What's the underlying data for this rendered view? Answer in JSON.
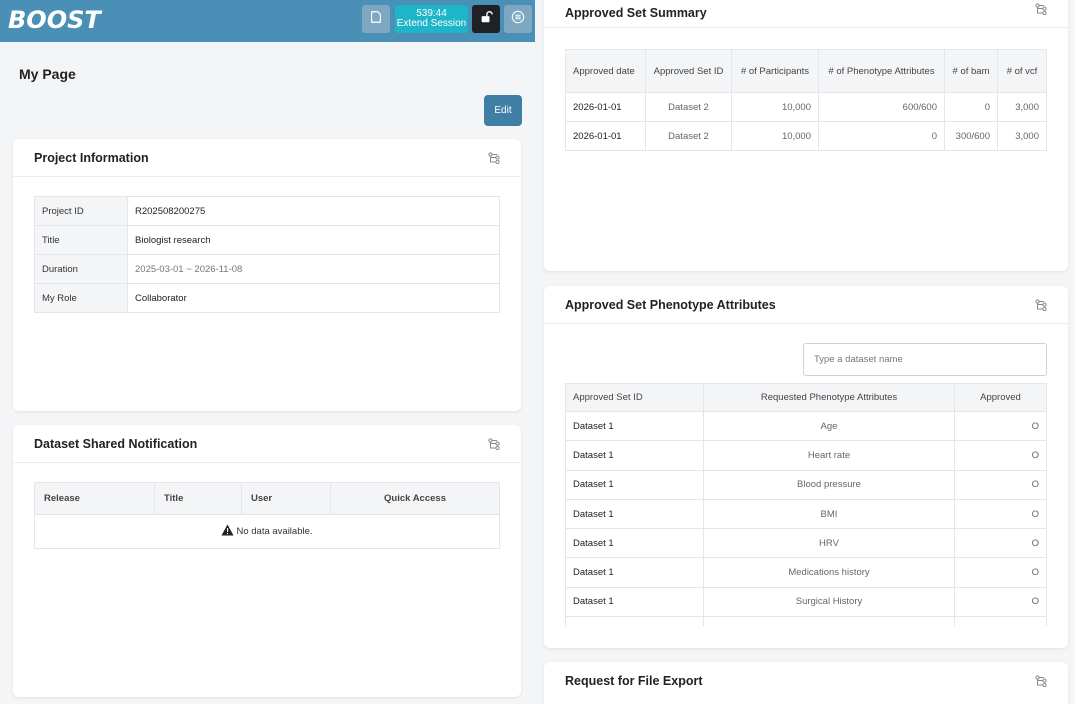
{
  "header": {
    "logo": "BOOST",
    "session_time": "539:44",
    "session_label": "Extend Session"
  },
  "page": {
    "title": "My Page",
    "edit_label": "Edit"
  },
  "project_info": {
    "title": "Project Information",
    "rows": [
      {
        "label": "Project ID",
        "value": "R202508200275"
      },
      {
        "label": "Title",
        "value": "Biologist research"
      },
      {
        "label": "Duration",
        "value": "2025-03-01 ~ 2026-11-08"
      },
      {
        "label": "My Role",
        "value": "Collaborator"
      }
    ]
  },
  "dataset_notification": {
    "title": "Dataset Shared Notification",
    "columns": [
      "Release",
      "Title",
      "User",
      "Quick Access"
    ],
    "empty_text": "No data available."
  },
  "approved_summary": {
    "title": "Approved Set Summary",
    "columns": [
      "Approved date",
      "Approved Set ID",
      "# of Participants",
      "# of Phenotype Attributes",
      "# of bam",
      "# of vcf"
    ],
    "rows": [
      [
        "2026-01-01",
        "Dataset 2",
        "10,000",
        "600/600",
        "0",
        "3,000"
      ],
      [
        "2026-01-01",
        "Dataset 2",
        "10,000",
        "0",
        "300/600",
        "3,000"
      ]
    ]
  },
  "phenotype_attributes": {
    "title": "Approved Set Phenotype Attributes",
    "search_placeholder": "Type a dataset name",
    "columns": [
      "Approved Set ID",
      "Requested Phenotype Attributes",
      "Approved"
    ],
    "rows": [
      [
        "Dataset 1",
        "Age",
        "O"
      ],
      [
        "Dataset 1",
        "Heart rate",
        "O"
      ],
      [
        "Dataset 1",
        "Blood pressure",
        "O"
      ],
      [
        "Dataset 1",
        "BMI",
        "O"
      ],
      [
        "Dataset 1",
        "HRV",
        "O"
      ],
      [
        "Dataset 1",
        "Medications history",
        "O"
      ],
      [
        "Dataset 1",
        "Surgical History",
        "O"
      ],
      [
        "",
        "",
        ""
      ]
    ]
  },
  "file_export": {
    "title": "Request for File Export"
  }
}
